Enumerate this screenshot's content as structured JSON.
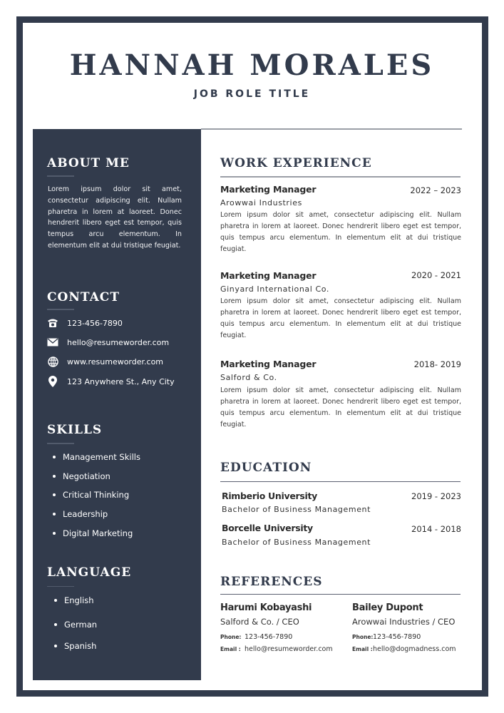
{
  "header": {
    "name": "HANNAH MORALES",
    "role": "JOB ROLE TITLE"
  },
  "colors": {
    "primary": "#323b4c",
    "rule": "#9a9ea6",
    "text": "#2b2b2b"
  },
  "sidebar": {
    "about": {
      "heading": "ABOUT ME",
      "text": "Lorem ipsum dolor sit amet, consectetur adipiscing elit. Nullam pharetra in lorem at laoreet. Donec hendrerit libero eget est tempor, quis tempus arcu elementum. In elementum elit at dui tristique feugiat."
    },
    "contact": {
      "heading": "CONTACT",
      "items": [
        {
          "icon": "phone-icon",
          "value": "123-456-7890"
        },
        {
          "icon": "email-icon",
          "value": "hello@resumeworder.com"
        },
        {
          "icon": "globe-icon",
          "value": "www.resumeworder.com"
        },
        {
          "icon": "location-pin-icon",
          "value": "123 Anywhere St., Any City"
        }
      ]
    },
    "skills": {
      "heading": "SKILLS",
      "items": [
        "Management Skills",
        "Negotiation",
        "Critical Thinking",
        "Leadership",
        "Digital Marketing"
      ]
    },
    "language": {
      "heading": "LANGUAGE",
      "items": [
        "English",
        "German",
        "Spanish"
      ]
    }
  },
  "main": {
    "experience": {
      "heading": "WORK EXPERIENCE",
      "jobs": [
        {
          "title": "Marketing Manager",
          "dates": "2022 – 2023",
          "company": "Arowwai Industries",
          "description": "Lorem ipsum dolor sit amet, consectetur adipiscing elit. Nullam pharetra in lorem at laoreet. Donec hendrerit libero eget est tempor, quis tempus arcu elementum. In elementum elit at dui tristique feugiat."
        },
        {
          "title": "Marketing Manager",
          "dates": "2020 - 2021",
          "company": "Ginyard International Co.",
          "description": "Lorem ipsum dolor sit amet, consectetur adipiscing elit. Nullam pharetra in lorem at laoreet. Donec hendrerit libero eget est tempor, quis tempus arcu elementum. In elementum elit at dui tristique feugiat."
        },
        {
          "title": "Marketing Manager",
          "dates": "2018- 2019",
          "company": "Salford & Co.",
          "description": "Lorem ipsum dolor sit amet, consectetur adipiscing elit. Nullam pharetra in lorem at laoreet. Donec hendrerit libero eget est tempor, quis tempus arcu elementum. In elementum elit at dui tristique feugiat."
        }
      ]
    },
    "education": {
      "heading": "EDUCATION",
      "items": [
        {
          "school": "Rimberio University",
          "dates": "2019 - 2023",
          "degree": "Bachelor of Business Management"
        },
        {
          "school": "Borcelle University",
          "dates": "2014 - 2018",
          "degree": "Bachelor of Business Management"
        }
      ]
    },
    "references": {
      "heading": "REFERENCES",
      "phone_label": "Phone:",
      "email_label": "Email :",
      "items": [
        {
          "name": "Harumi Kobayashi",
          "company": "Salford & Co. / CEO",
          "phone": "123-456-7890",
          "email": "hello@resumeworder.com"
        },
        {
          "name": "Bailey Dupont",
          "company": "Arowwai Industries / CEO",
          "phone": "123-456-7890",
          "email": "hello@dogmadness.com"
        }
      ]
    }
  }
}
